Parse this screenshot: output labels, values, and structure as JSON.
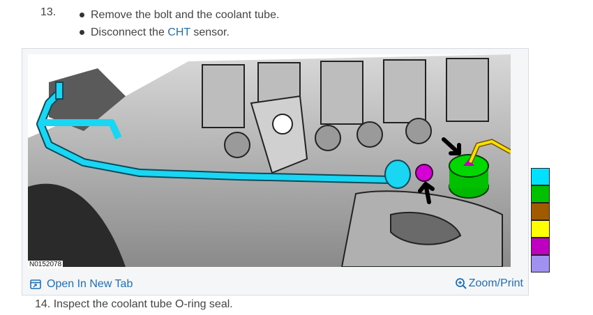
{
  "step13": {
    "number": "13.",
    "bullet1": "Remove the bolt and the coolant tube.",
    "bullet2_before": "Disconnect the ",
    "bullet2_link": "CHT",
    "bullet2_after": " sensor."
  },
  "figure": {
    "id": "N0152078",
    "open_tab_label": "Open In New Tab",
    "zoom_label": "Zoom/Print",
    "icons": {
      "open_tab": "open-in-new-tab-icon",
      "zoom": "magnifier-plus-icon"
    }
  },
  "legend": {
    "colors": [
      "#00e0ff",
      "#00c000",
      "#a05a00",
      "#ffff00",
      "#c000c0",
      "#a090f0"
    ]
  },
  "step14": {
    "text": "14. Inspect the coolant tube O-ring seal."
  }
}
